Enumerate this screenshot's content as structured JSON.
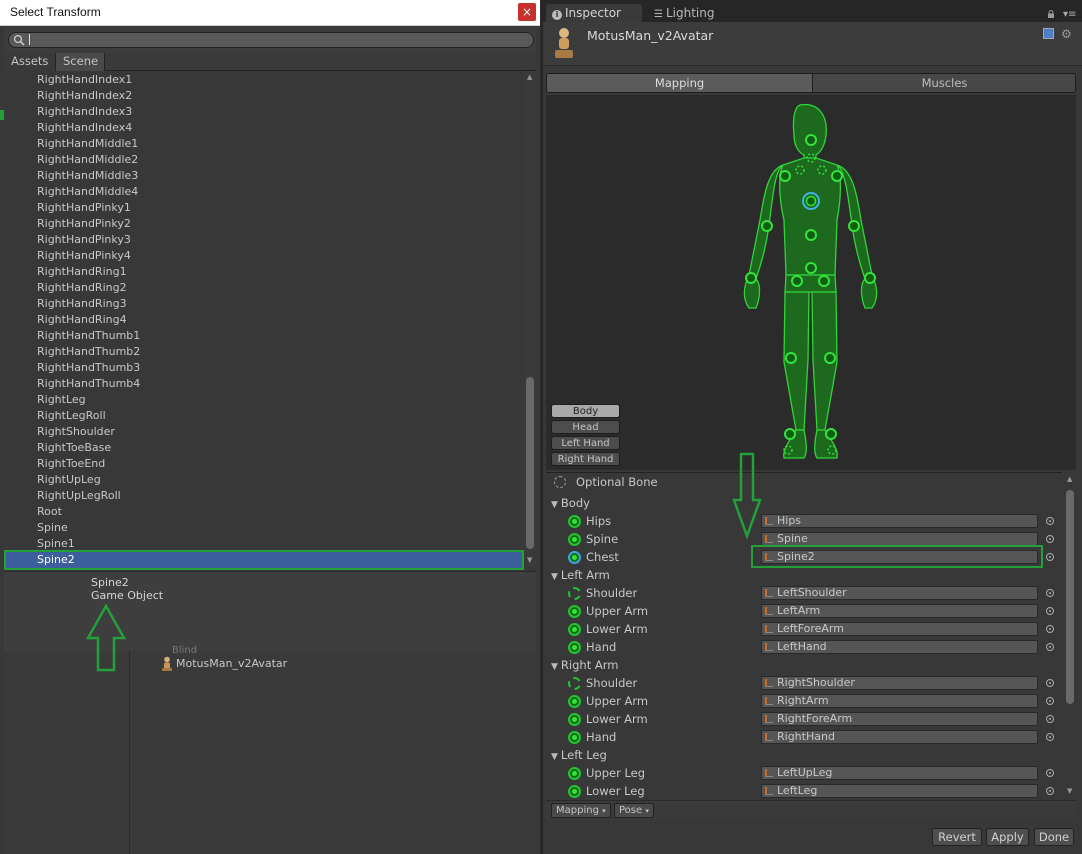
{
  "dialog": {
    "title": "Select Transform",
    "close": "×",
    "search_value": "",
    "tabs": {
      "assets": "Assets",
      "scene": "Scene"
    },
    "items": [
      "RightHandIndex1",
      "RightHandIndex2",
      "RightHandIndex3",
      "RightHandIndex4",
      "RightHandMiddle1",
      "RightHandMiddle2",
      "RightHandMiddle3",
      "RightHandMiddle4",
      "RightHandPinky1",
      "RightHandPinky2",
      "RightHandPinky3",
      "RightHandPinky4",
      "RightHandRing1",
      "RightHandRing2",
      "RightHandRing3",
      "RightHandRing4",
      "RightHandThumb1",
      "RightHandThumb2",
      "RightHandThumb3",
      "RightHandThumb4",
      "RightLeg",
      "RightLegRoll",
      "RightShoulder",
      "RightToeBase",
      "RightToeEnd",
      "RightUpLeg",
      "RightUpLegRoll",
      "Root",
      "Spine",
      "Spine1",
      "Spine2"
    ],
    "selected_index": 30,
    "info": {
      "name": "Spine2",
      "type": "Game Object"
    },
    "background_asset": "MotusMan_v2Avatar",
    "background_partial": "Blind"
  },
  "inspector": {
    "tabs": {
      "inspector": "Inspector",
      "lighting": "Lighting"
    },
    "asset_name": "MotusMan_v2Avatar",
    "segments": {
      "mapping": "Mapping",
      "muscles": "Muscles"
    },
    "view_buttons": {
      "body": "Body",
      "head": "Head",
      "left_hand": "Left Hand",
      "right_hand": "Right Hand"
    },
    "optional_bone": "Optional Bone",
    "sections": [
      {
        "title": "Body",
        "bones": [
          {
            "label": "Hips",
            "value": "Hips",
            "icon": "solid"
          },
          {
            "label": "Spine",
            "value": "Spine",
            "icon": "solid"
          },
          {
            "label": "Chest",
            "value": "Spine2",
            "icon": "selected"
          }
        ]
      },
      {
        "title": "Left Arm",
        "bones": [
          {
            "label": "Shoulder",
            "value": "LeftShoulder",
            "icon": "dashed"
          },
          {
            "label": "Upper Arm",
            "value": "LeftArm",
            "icon": "solid"
          },
          {
            "label": "Lower Arm",
            "value": "LeftForeArm",
            "icon": "solid"
          },
          {
            "label": "Hand",
            "value": "LeftHand",
            "icon": "solid"
          }
        ]
      },
      {
        "title": "Right Arm",
        "bones": [
          {
            "label": "Shoulder",
            "value": "RightShoulder",
            "icon": "dashed"
          },
          {
            "label": "Upper Arm",
            "value": "RightArm",
            "icon": "solid"
          },
          {
            "label": "Lower Arm",
            "value": "RightForeArm",
            "icon": "solid"
          },
          {
            "label": "Hand",
            "value": "RightHand",
            "icon": "solid"
          }
        ]
      },
      {
        "title": "Left Leg",
        "bones": [
          {
            "label": "Upper Leg",
            "value": "LeftUpLeg",
            "icon": "solid"
          },
          {
            "label": "Lower Leg",
            "value": "LeftLeg",
            "icon": "solid"
          }
        ]
      }
    ],
    "footer": {
      "mapping_dropdown": "Mapping",
      "pose_dropdown": "Pose"
    },
    "buttons": {
      "revert": "Revert",
      "apply": "Apply",
      "done": "Done"
    }
  },
  "colors": {
    "highlight_green": "#22a03a",
    "selection_blue": "#3d5e9d",
    "bone_green": "#23c331"
  }
}
